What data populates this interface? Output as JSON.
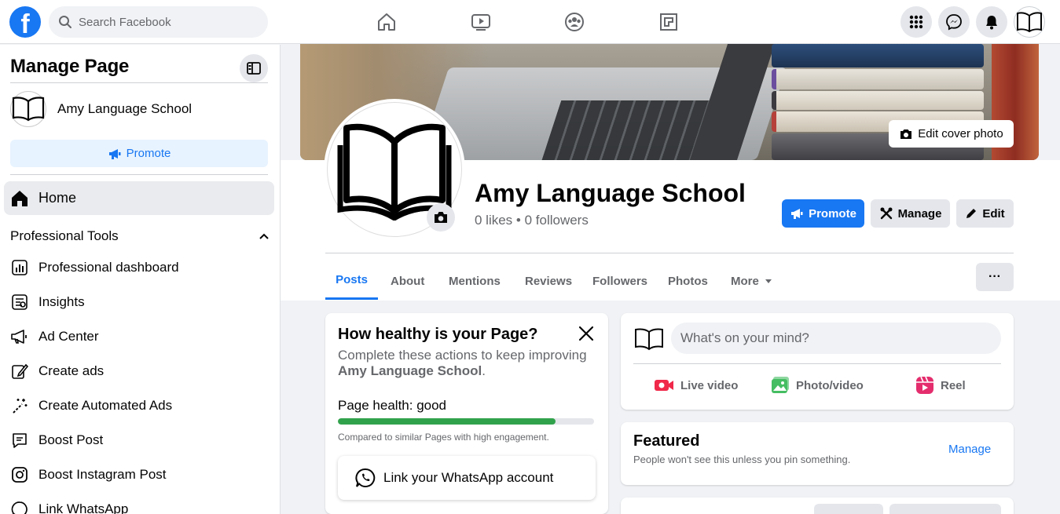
{
  "topbar": {
    "logo": "f",
    "search_placeholder": "Search Facebook",
    "nav_icons": [
      "home-icon",
      "video-icon",
      "groups-icon",
      "gaming-icon"
    ],
    "right_icons": [
      "menu-grid-icon",
      "messenger-icon",
      "notifications-icon",
      "account-avatar"
    ]
  },
  "sidebar": {
    "title": "Manage Page",
    "page_name": "Amy Language School",
    "promote_label": "Promote",
    "home_label": "Home",
    "section_title": "Professional Tools",
    "items": [
      {
        "label": "Professional dashboard",
        "icon": "dashboard-icon"
      },
      {
        "label": "Insights",
        "icon": "insights-icon"
      },
      {
        "label": "Ad Center",
        "icon": "megaphone-icon"
      },
      {
        "label": "Create ads",
        "icon": "pencil-icon"
      },
      {
        "label": "Create Automated Ads",
        "icon": "magic-wand-icon"
      },
      {
        "label": "Boost Post",
        "icon": "boost-post-icon"
      },
      {
        "label": "Boost Instagram Post",
        "icon": "instagram-icon"
      },
      {
        "label": "Link WhatsApp",
        "icon": "whatsapp-icon"
      }
    ]
  },
  "cover": {
    "edit_label": "Edit cover photo"
  },
  "profile": {
    "name": "Amy Language School",
    "stats": "0 likes • 0 followers",
    "buttons": {
      "promote": "Promote",
      "manage": "Manage",
      "edit": "Edit"
    },
    "tabs": [
      "Posts",
      "About",
      "Mentions",
      "Reviews",
      "Followers",
      "Photos",
      "More"
    ],
    "active_tab": "Posts",
    "more_dots": "···"
  },
  "health": {
    "title": "How healthy is your Page?",
    "desc_prefix": "Complete these actions to keep improving",
    "desc_page": "Amy Language School",
    "desc_suffix": ".",
    "label": "Page health: good",
    "progress": 0.85,
    "note": "Compared to similar Pages with high engagement.",
    "whatsapp_label": "Link your WhatsApp account"
  },
  "composer": {
    "placeholder": "What's on your mind?",
    "actions": [
      {
        "label": "Live video",
        "icon": "live-video-icon"
      },
      {
        "label": "Photo/video",
        "icon": "photo-video-icon"
      },
      {
        "label": "Reel",
        "icon": "reel-icon"
      }
    ]
  },
  "featured": {
    "title": "Featured",
    "subtitle": "People won't see this unless you pin something.",
    "manage_label": "Manage"
  },
  "colors": {
    "brand": "#1877f2",
    "health_good": "#31a24c",
    "live_red": "#f02849",
    "photo_green": "#45bd62",
    "reel_pink": "#e42d6d"
  }
}
